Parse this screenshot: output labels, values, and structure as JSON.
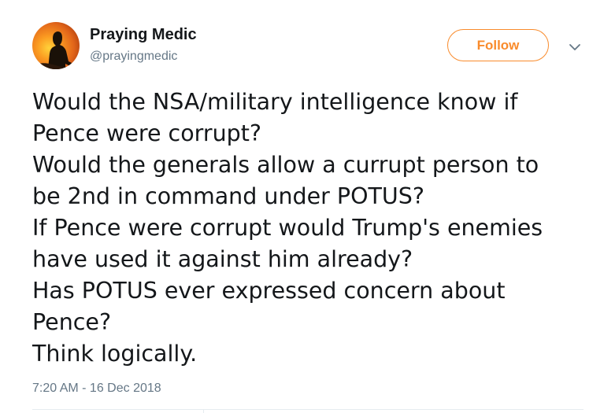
{
  "author": {
    "display_name": "Praying Medic",
    "handle": "@prayingmedic",
    "avatar_icon": "silhouette-sunset-avatar"
  },
  "follow_button": {
    "label": "Follow",
    "accent_color": "#f98b2c"
  },
  "menu": {
    "icon": "chevron-down-icon"
  },
  "tweet": {
    "lines": [
      "Would the NSA/military intelligence know if",
      "Pence were corrupt?",
      "Would the generals allow a currupt person to",
      "be 2nd in command under POTUS?",
      "If Pence were corrupt would Trump's enemies",
      "have used it against him already?",
      "Has POTUS ever expressed concern about",
      "Pence?",
      "Think logically."
    ],
    "timestamp": "7:20 AM - 16 Dec 2018"
  },
  "colors": {
    "text_primary": "#14171a",
    "text_secondary": "#657786",
    "divider": "#e6ecf0"
  }
}
